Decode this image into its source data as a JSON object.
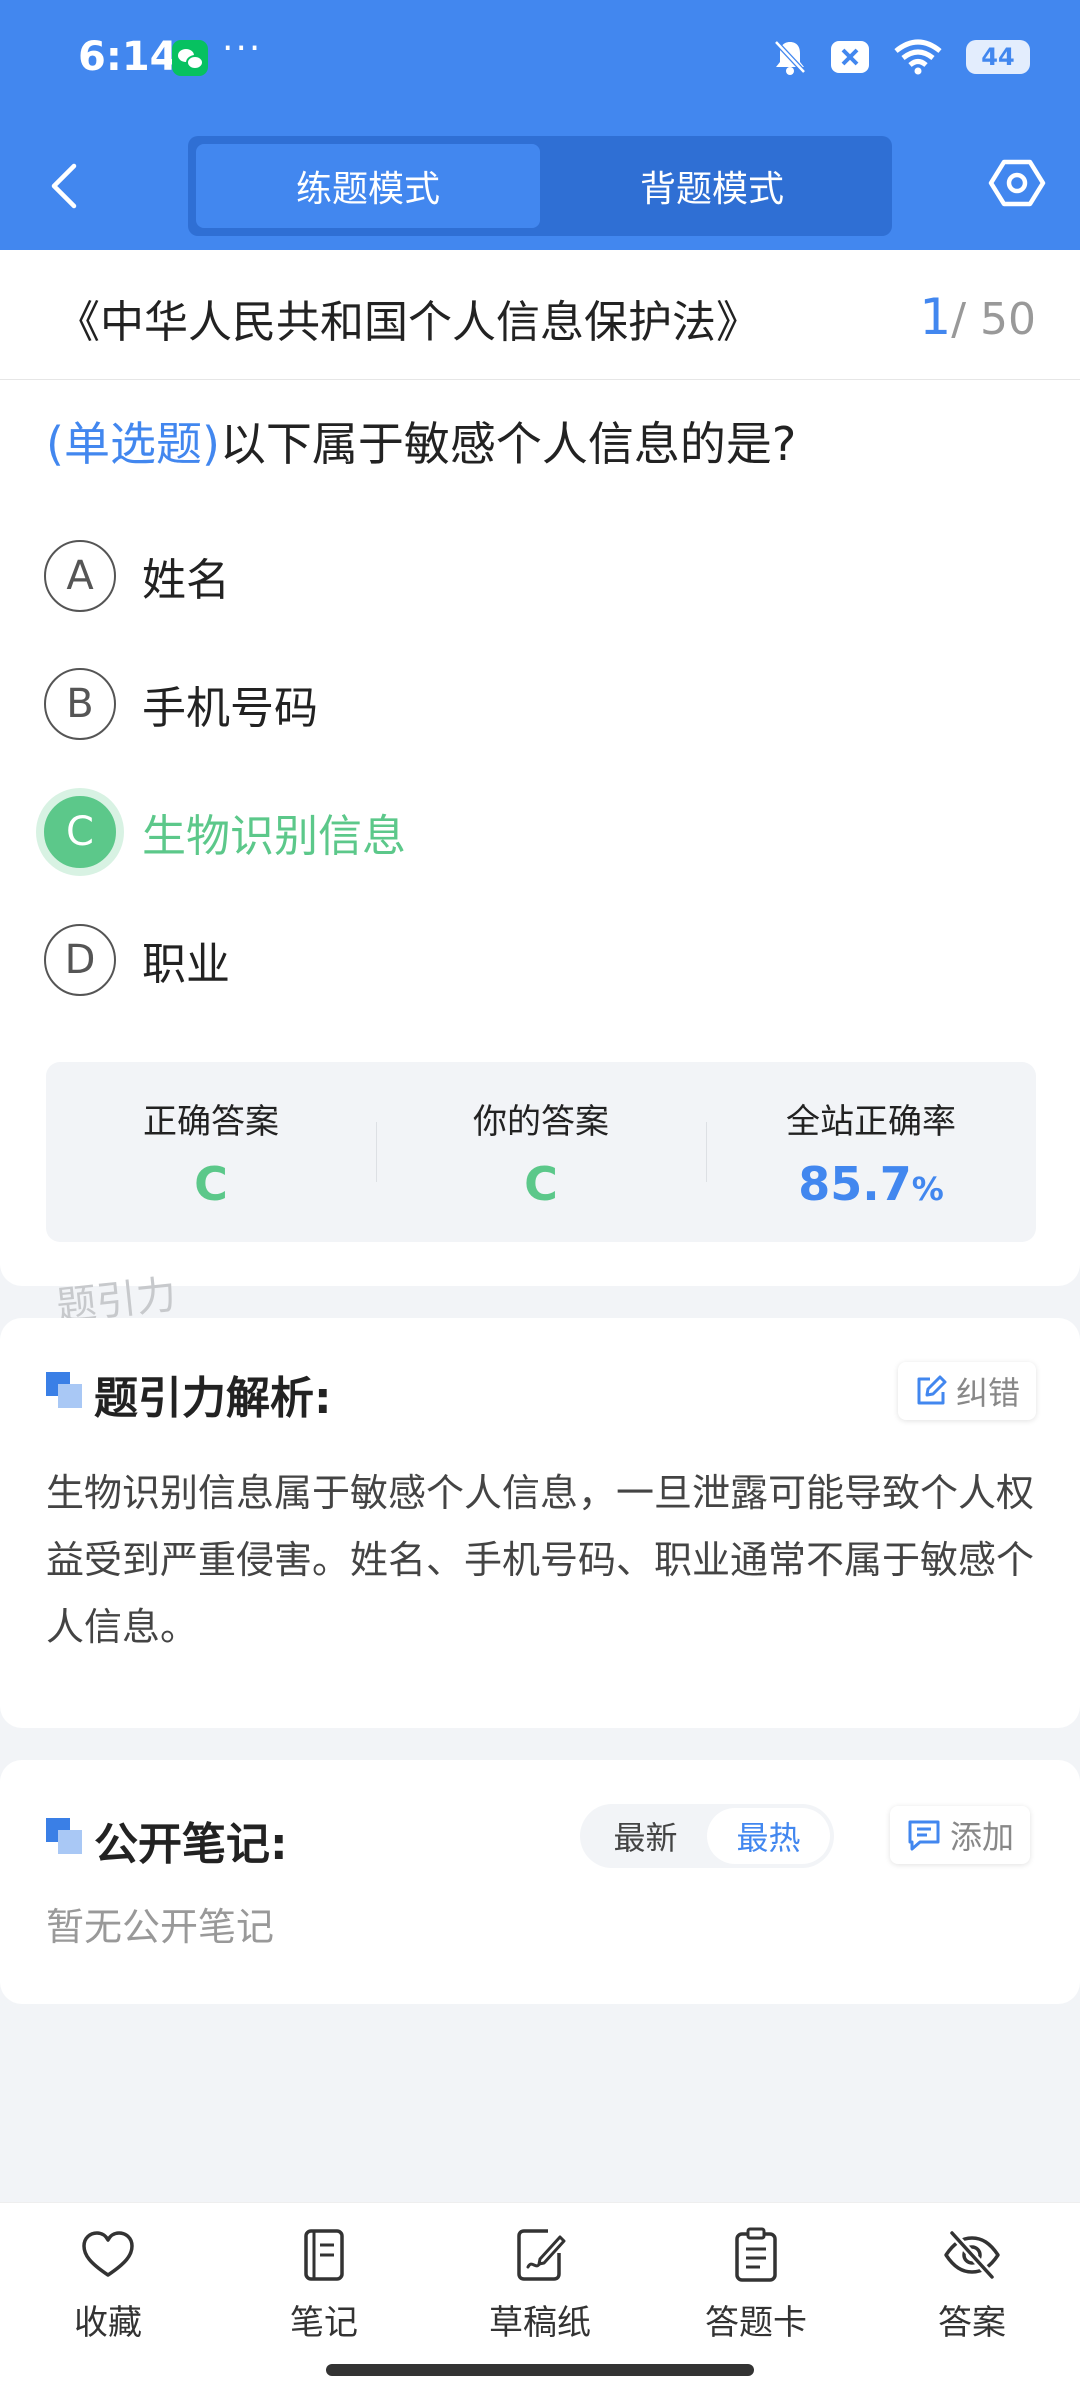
{
  "status_bar": {
    "time": "6:14",
    "more": "···",
    "battery": "44"
  },
  "header": {
    "modes": [
      {
        "label": "练题模式",
        "active": true
      },
      {
        "label": "背题模式",
        "active": false
      }
    ]
  },
  "paper": {
    "title": "《中华人民共和国个人信息保护法》",
    "current": "1",
    "total": "/ 50"
  },
  "question": {
    "type": "(单选题)",
    "text": "以下属于敏感个人信息的是?",
    "options": [
      {
        "key": "A",
        "text": "姓名"
      },
      {
        "key": "B",
        "text": "手机号码"
      },
      {
        "key": "C",
        "text": "生物识别信息"
      },
      {
        "key": "D",
        "text": "职业"
      }
    ]
  },
  "answer": {
    "correct_label": "正确答案",
    "correct_value": "C",
    "yours_label": "你的答案",
    "yours_value": "C",
    "rate_label": "全站正确率",
    "rate_value": "85.7",
    "rate_unit": "%"
  },
  "watermark": "题引力",
  "analysis": {
    "title": "题引力解析:",
    "fix_label": "纠错",
    "text": "生物识别信息属于敏感个人信息，一旦泄露可能导致个人权益受到严重侵害。姓名、手机号码、职业通常不属于敏感个人信息。"
  },
  "notes": {
    "title": "公开笔记:",
    "sort_newest": "最新",
    "sort_hottest": "最热",
    "add_label": "添加",
    "empty_text": "暂无公开笔记"
  },
  "bottom_bar": {
    "favorite": "收藏",
    "notes": "笔记",
    "scratch": "草稿纸",
    "answer_card": "答题卡",
    "answer": "答案"
  },
  "colors": {
    "primary": "#4287ef",
    "correct": "#5cc88a"
  }
}
